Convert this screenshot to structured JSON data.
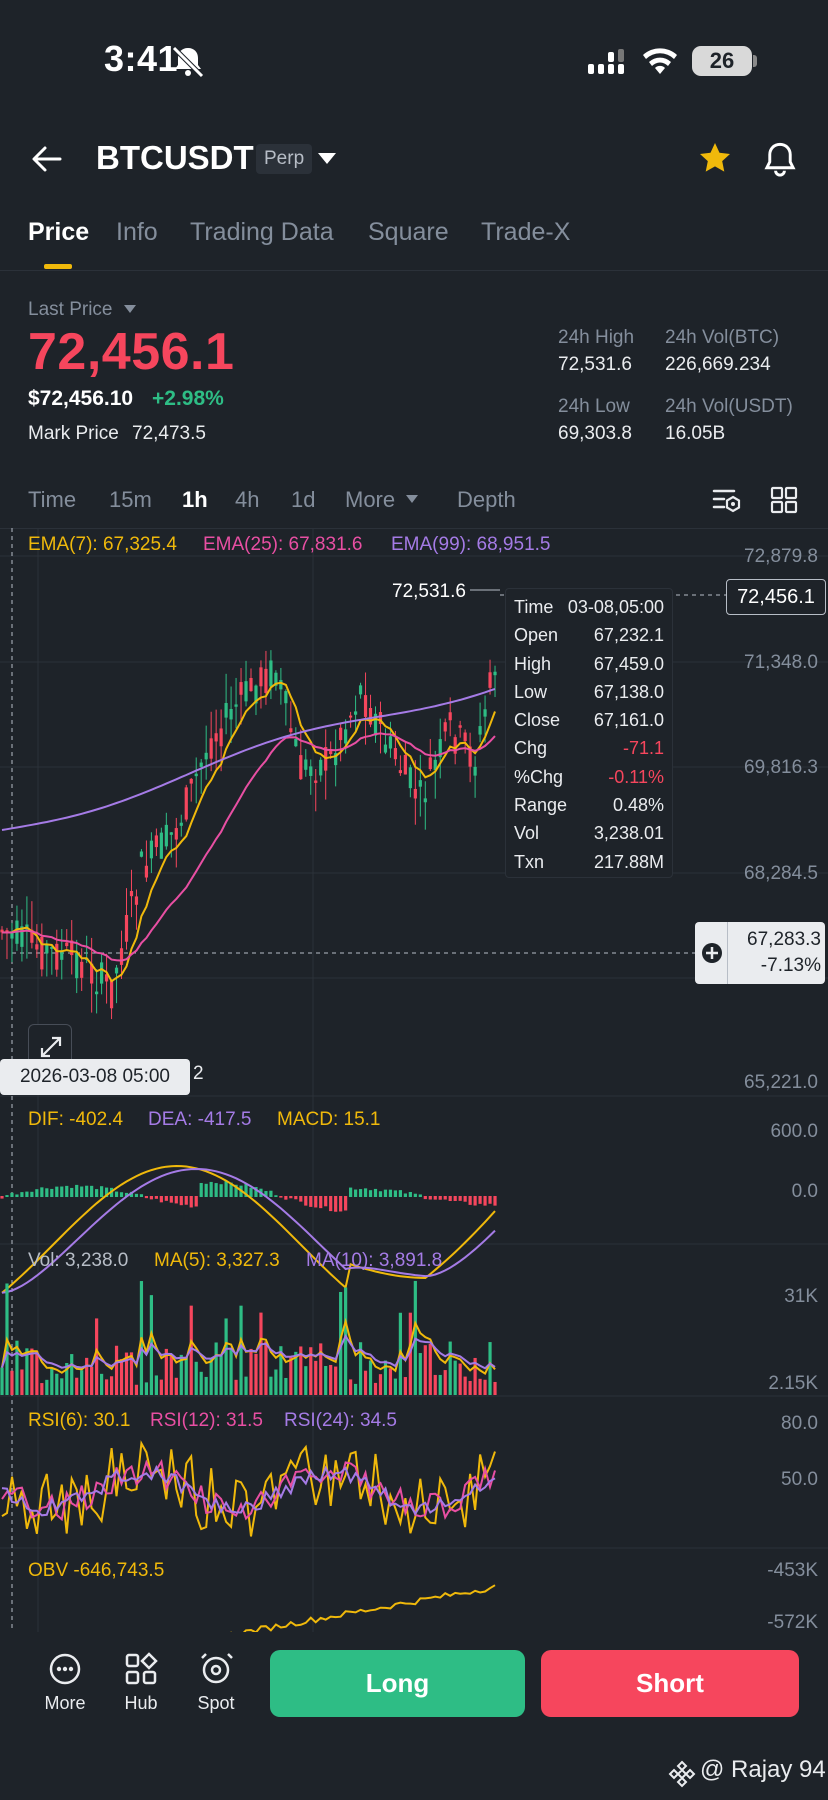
{
  "status": {
    "time": "3:41",
    "battery": "26"
  },
  "header": {
    "symbol": "BTCUSDT",
    "badge": "Perp"
  },
  "tabs": [
    "Price",
    "Info",
    "Trading Data",
    "Square",
    "Trade-X"
  ],
  "summary": {
    "last_price_label": "Last Price",
    "last_price": "72,456.1",
    "usd_price": "$72,456.10",
    "change_pct": "+2.98%",
    "mark_price_label": "Mark Price",
    "mark_price": "72,473.5",
    "high_label": "24h High",
    "high": "72,531.6",
    "vol_btc_label": "24h Vol(BTC)",
    "vol_btc": "226,669.234",
    "low_label": "24h Low",
    "low": "69,303.8",
    "vol_usdt_label": "24h Vol(USDT)",
    "vol_usdt": "16.05B"
  },
  "intervals": [
    "Time",
    "15m",
    "1h",
    "4h",
    "1d",
    "More",
    "Depth"
  ],
  "ema": {
    "ema7": "EMA(7): 67,325.4",
    "ema25": "EMA(25): 67,831.6",
    "ema99": "EMA(99): 68,951.5"
  },
  "price_axis": [
    "72,879.8",
    "71,348.0",
    "69,816.3",
    "68,284.5",
    "65,221.0"
  ],
  "high_marker": "72,531.6",
  "current_price_tag": "72,456.1",
  "crosshair": {
    "price": "67,283.3",
    "pct": "-7.13%",
    "date": "2026-03-08 05:00",
    "low_marker_suffix": "2"
  },
  "tooltip": [
    {
      "k": "Time",
      "v": "03-08,05:00"
    },
    {
      "k": "Open",
      "v": "67,232.1"
    },
    {
      "k": "High",
      "v": "67,459.0"
    },
    {
      "k": "Low",
      "v": "67,138.0"
    },
    {
      "k": "Close",
      "v": "67,161.0"
    },
    {
      "k": "Chg",
      "v": "-71.1"
    },
    {
      "k": "%Chg",
      "v": "-0.11%"
    },
    {
      "k": "Range",
      "v": "0.48%"
    },
    {
      "k": "Vol",
      "v": "3,238.01"
    },
    {
      "k": "Txn",
      "v": "217.88M"
    }
  ],
  "macd": {
    "dif": "DIF: -402.4",
    "dea": "DEA: -417.5",
    "macd": "MACD: 15.1",
    "axis_top": "600.0",
    "axis_zero": "0.0"
  },
  "volume": {
    "vol": "Vol: 3,238.0",
    "ma5": "MA(5): 3,327.3",
    "ma10": "MA(10): 3,891.8",
    "axis_top": "31K",
    "axis_bottom": "2.15K"
  },
  "rsi": {
    "rsi6": "RSI(6): 30.1",
    "rsi12": "RSI(12): 31.5",
    "rsi24": "RSI(24): 34.5",
    "axis_top": "80.0",
    "axis_mid": "50.0"
  },
  "obv": {
    "label": "OBV -646,743.5",
    "axis_top": "-453K",
    "axis_cut": "-572K"
  },
  "bottom_nav": {
    "more": "More",
    "hub": "Hub",
    "spot": "Spot",
    "long": "Long",
    "short": "Short"
  },
  "watermark": "@ Rajay 94",
  "colors": {
    "up": "#2ebd85",
    "down": "#f6465d",
    "ema7": "#f0b90b",
    "ema25": "#e84fa3",
    "ema99": "#a57be6",
    "accent": "#f0b90b"
  }
}
